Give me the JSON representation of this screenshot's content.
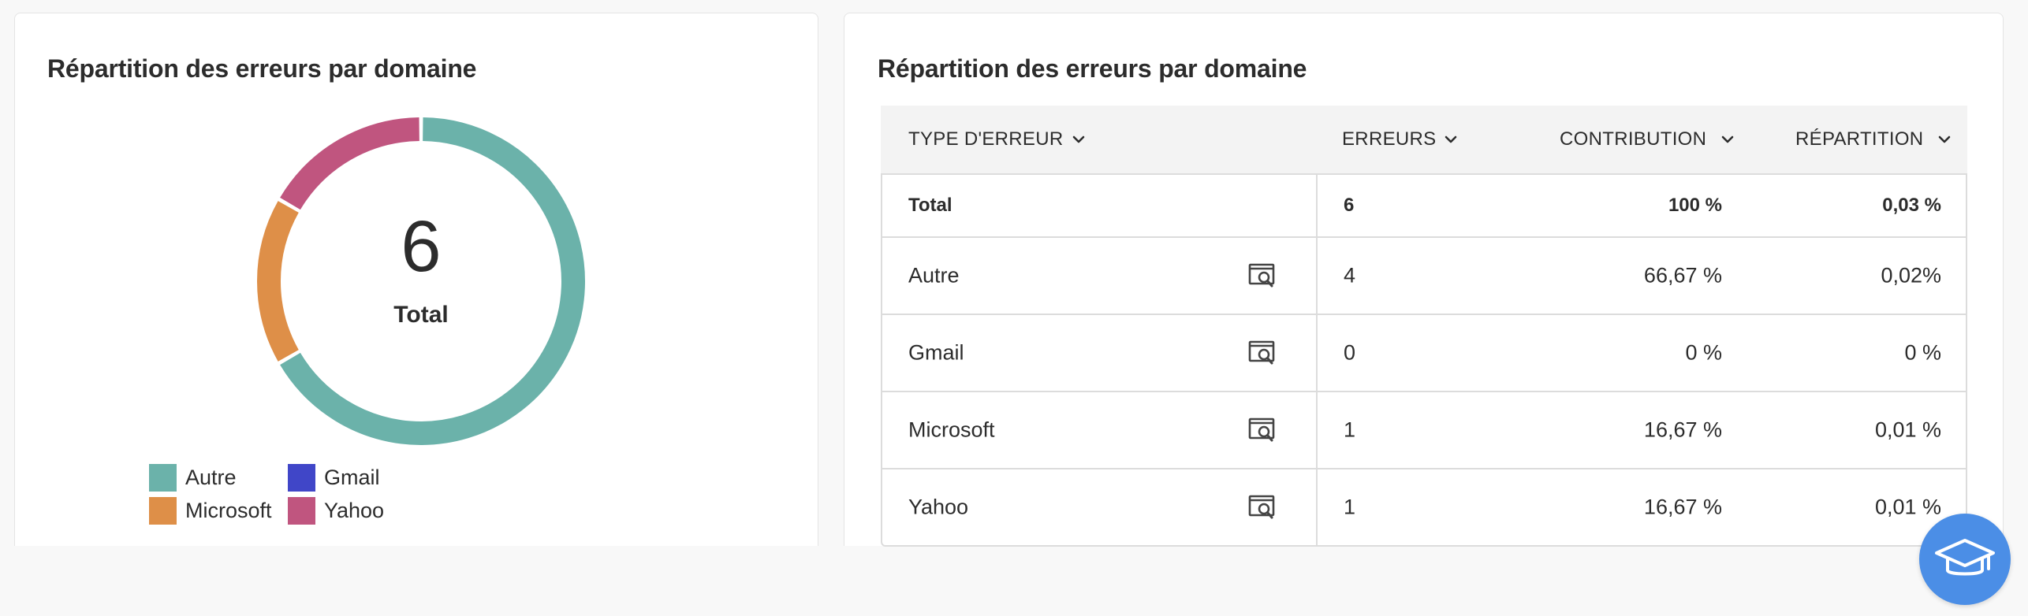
{
  "left_card": {
    "title": "Répartition des erreurs par domaine",
    "donut_center": {
      "value": "6",
      "label": "Total"
    }
  },
  "chart_data": {
    "type": "pie",
    "categories": [
      "Autre",
      "Gmail",
      "Microsoft",
      "Yahoo"
    ],
    "values": [
      4,
      0,
      1,
      1
    ],
    "colors": [
      "#6bb2aa",
      "#4046c8",
      "#de8f48",
      "#c0557f"
    ],
    "legend": "bottom-left"
  },
  "legend": {
    "items": [
      {
        "label": "Autre",
        "color": "#6bb2aa"
      },
      {
        "label": "Gmail",
        "color": "#4046c8"
      },
      {
        "label": "Microsoft",
        "color": "#de8f48"
      },
      {
        "label": "Yahoo",
        "color": "#c0557f"
      }
    ]
  },
  "right_card": {
    "title": "Répartition des erreurs par domaine",
    "table": {
      "headers": {
        "type": "TYPE D'ERREUR",
        "errors": "ERREURS",
        "contribution": "CONTRIBUTION",
        "repartition": "RÉPARTITION"
      },
      "total": {
        "name": "Total",
        "errors": "6",
        "contribution": "100 %",
        "repartition": "0,03 %"
      },
      "rows": [
        {
          "name": "Autre",
          "errors": "4",
          "contribution": "66,67 %",
          "repartition": "0,02%"
        },
        {
          "name": "Gmail",
          "errors": "0",
          "contribution": "0 %",
          "repartition": "0 %"
        },
        {
          "name": "Microsoft",
          "errors": "1",
          "contribution": "16,67 %",
          "repartition": "0,01 %"
        },
        {
          "name": "Yahoo",
          "errors": "1",
          "contribution": "16,67 %",
          "repartition": "0,01 %"
        }
      ]
    }
  },
  "icons": {
    "row_action": "inspect-screen-icon",
    "sort": "chevron-down-icon",
    "fab": "graduation-cap-icon"
  },
  "colors": {
    "fab_background": "#4b8ee6",
    "header_background": "#f3f3f3",
    "border": "#dcdcdc"
  }
}
